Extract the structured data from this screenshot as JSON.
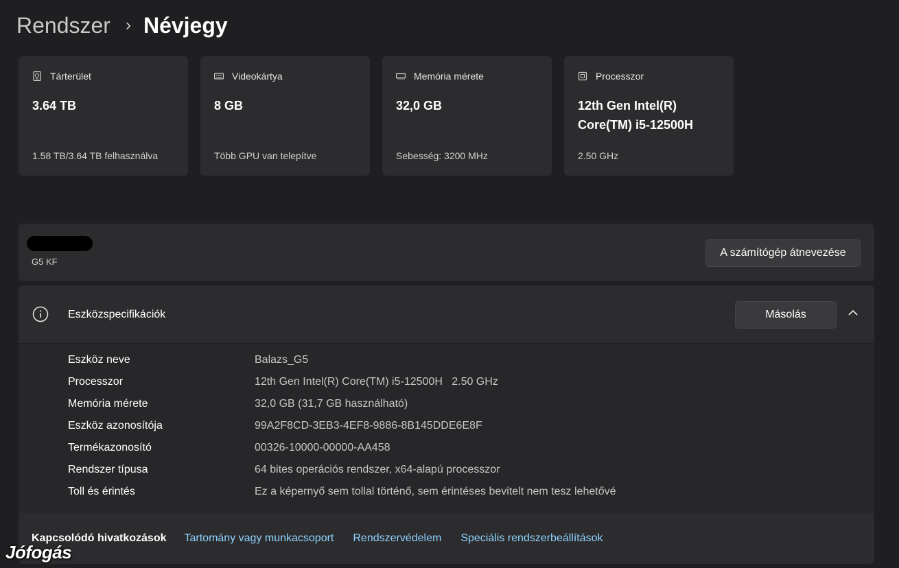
{
  "breadcrumb": {
    "parent": "Rendszer",
    "separator": "›",
    "current": "Névjegy"
  },
  "cards": [
    {
      "icon": "storage-icon",
      "label": "Tárterület",
      "value": "3.64 TB",
      "sub": "1.58 TB/3.64 TB felhasználva"
    },
    {
      "icon": "gpu-icon",
      "label": "Videokártya",
      "value": "8 GB",
      "sub": "Több GPU van telepítve"
    },
    {
      "icon": "memory-icon",
      "label": "Memória mérete",
      "value": "32,0 GB",
      "sub": "Sebesség: 3200 MHz"
    },
    {
      "icon": "processor-icon",
      "label": "Processzor",
      "value": "12th Gen Intel(R) Core(TM) i5-12500H",
      "sub": "2.50 GHz"
    }
  ],
  "device": {
    "model": "G5 KF",
    "rename_label": "A számítógép átnevezése"
  },
  "specs": {
    "title": "Eszközspecifikációk",
    "copy_label": "Másolás",
    "rows": [
      {
        "label": "Eszköz neve",
        "value": "Balazs_G5"
      },
      {
        "label": "Processzor",
        "value": "12th Gen Intel(R) Core(TM) i5-12500H   2.50 GHz"
      },
      {
        "label": "Memória mérete",
        "value": "32,0 GB (31,7 GB használható)"
      },
      {
        "label": "Eszköz azonosítója",
        "value": "99A2F8CD-3EB3-4EF8-9886-8B145DDE6E8F"
      },
      {
        "label": "Termékazonosító",
        "value": "00326-10000-00000-AA458"
      },
      {
        "label": "Rendszer típusa",
        "value": "64 bites operációs rendszer, x64-alapú processzor"
      },
      {
        "label": "Toll és érintés",
        "value": "Ez a képernyő sem tollal történő, sem érintéses bevitelt nem tesz lehetővé"
      }
    ]
  },
  "related": {
    "label": "Kapcsolódó hivatkozások",
    "links": [
      "Tartomány vagy munkacsoport",
      "Rendszervédelem",
      "Speciális rendszerbeállítások"
    ]
  },
  "watermark": "Jófogás",
  "colors": {
    "background": "#1f1f21",
    "card": "#2c2c2e",
    "link": "#8fd3ff"
  }
}
